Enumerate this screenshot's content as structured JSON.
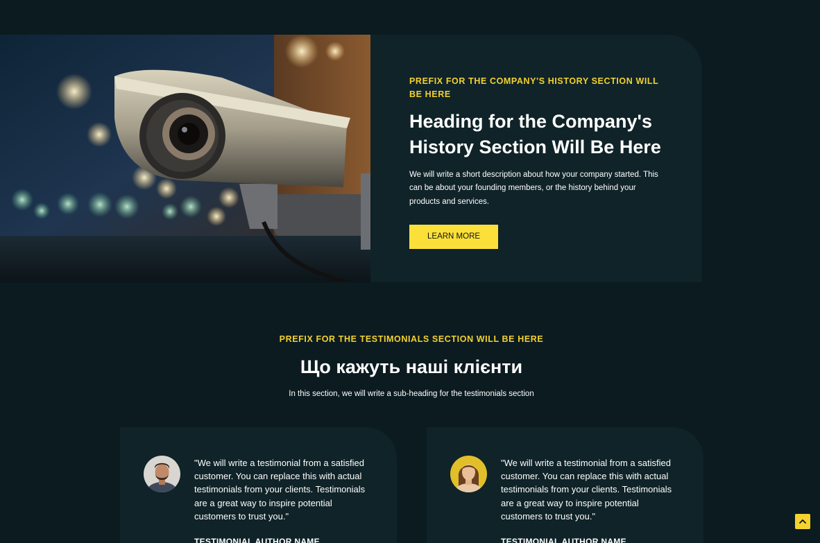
{
  "history": {
    "prefix": "PREFIX FOR THE COMPANY'S HISTORY SECTION WILL BE HERE",
    "heading": "Heading for the Company's History Section Will Be Here",
    "description": "We will write a short description about how your company started. This can be about your founding members, or the history behind your products and services.",
    "button_label": "LEARN MORE",
    "image_icon": "security-camera-image"
  },
  "testimonials": {
    "prefix": "PREFIX FOR THE TESTIMONIALS SECTION WILL BE HERE",
    "heading": "Що кажуть наші клієнти",
    "subheading": "In this section, we will write a sub-heading for the testimonials section",
    "items": [
      {
        "quote": "\"We will write a testimonial from a satisfied customer. You can replace this with actual testimonials from your clients. Testimonials are a great way to inspire potential customers to trust you.\"",
        "author": "TESTIMONIAL AUTHOR NAME",
        "avatar_icon": "male-avatar"
      },
      {
        "quote": "\"We will write a testimonial from a satisfied customer. You can replace this with actual testimonials from your clients. Testimonials are a great way to inspire potential customers to trust you.\"",
        "author": "TESTIMONIAL AUTHOR NAME",
        "avatar_icon": "female-avatar"
      }
    ]
  },
  "scroll_top_icon": "chevron-up-icon",
  "colors": {
    "background": "#0b1b20",
    "panel": "#0f2328",
    "accent": "#f4d230",
    "button": "#fbe03a",
    "text": "#ffffff"
  }
}
